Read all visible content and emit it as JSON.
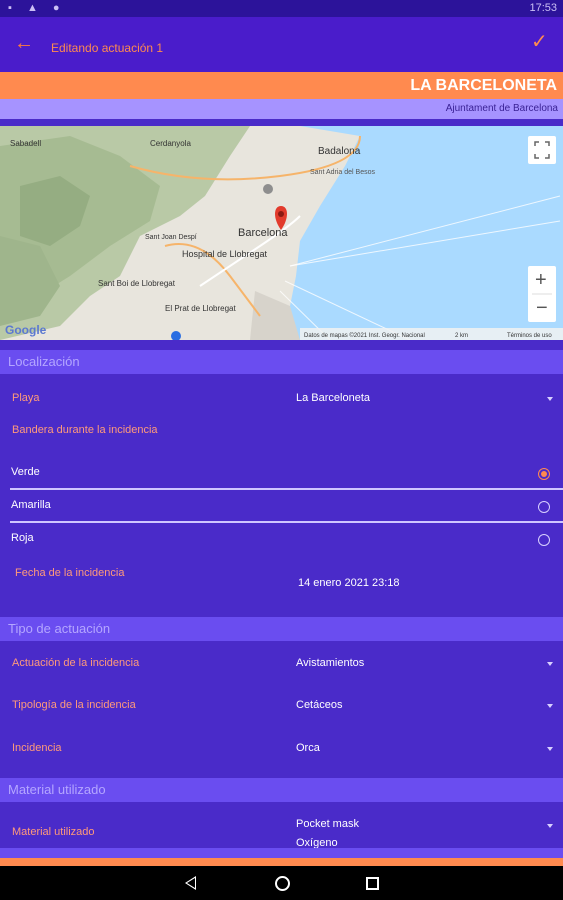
{
  "status": {
    "left_icons": "sim-icon warning-icon android-icon",
    "time": "17:53"
  },
  "appbar": {
    "title": "Editando actuación 1"
  },
  "header": {
    "beach": "LA BARCELONETA",
    "city": "Ajuntament de Barcelona"
  },
  "map": {
    "places": [
      "Badalona",
      "Barcelona",
      "Hospital de Llobregat",
      "El Prat de Llobregat",
      "Sant Boi de Llobregat",
      "Sant Adria del Besos",
      "Cerdanyola",
      "Sabadell",
      "Sant Joan Despí"
    ],
    "google": "Google",
    "attribution": "Datos de mapas ©2021 Inst. Geogr. Nacional",
    "scale": "2 km",
    "terms": "Términos de uso",
    "zoom_in": "+",
    "zoom_out": "−"
  },
  "localizacion": {
    "header": "Localización",
    "playa_label": "Playa",
    "playa_value": "La Barceloneta",
    "bandera_label": "Bandera durante la incidencia",
    "banderas": [
      {
        "label": "Verde",
        "checked": true
      },
      {
        "label": "Amarilla",
        "checked": false
      },
      {
        "label": "Roja",
        "checked": false
      }
    ],
    "fecha_label": "Fecha de la incidencia",
    "fecha_value": "14 enero 2021 23:18"
  },
  "tipo": {
    "header": "Tipo de actuación",
    "actuacion_label": "Actuación de la incidencia",
    "actuacion_value": "Avistamientos",
    "tipologia_label": "Tipología de la incidencia",
    "tipologia_value": "Cetáceos",
    "incidencia_label": "Incidencia",
    "incidencia_value": "Orca"
  },
  "material": {
    "header": "Material utilizado",
    "label": "Material utilizado",
    "value": "Pocket mask",
    "value2": "Oxígeno"
  },
  "colors": {
    "primary": "#4a2bc9",
    "accent": "#ff8a4f",
    "lilac": "#a693ff"
  }
}
